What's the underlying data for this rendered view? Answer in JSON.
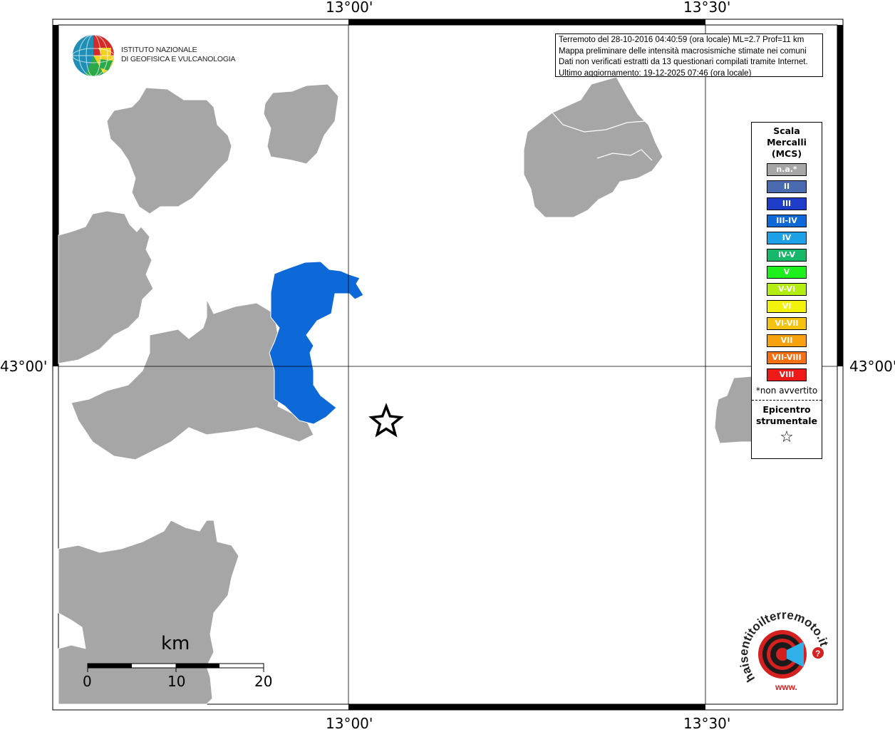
{
  "map": {
    "longitude_labels": [
      "13°00'",
      "13°30'"
    ],
    "latitude_labels": [
      "43°00'"
    ],
    "epicenter_icon": "star-icon"
  },
  "info": {
    "line1": "Terremoto del 28-10-2016 04:40:59 (ora locale) ML=2.7 Prof=11 km",
    "line2": "Mappa preliminare delle intensità macrosismiche stimate nei comuni",
    "line3": "Dati non verificati estratti da 13 questionari compilati tramite Internet.",
    "line4": "Ultimo aggiornamento: 19-12-2025 07:46 (ora locale)"
  },
  "legend": {
    "title_line1": "Scala",
    "title_line2": "Mercalli",
    "title_line3": "(MCS)",
    "items": [
      {
        "label": "n.a.*",
        "color": "#a6a6a6"
      },
      {
        "label": "II",
        "color": "#4a6bb0"
      },
      {
        "label": "III",
        "color": "#1d3cc7"
      },
      {
        "label": "III-IV",
        "color": "#0d68d8"
      },
      {
        "label": "IV",
        "color": "#1ea1e6"
      },
      {
        "label": "IV-V",
        "color": "#18b86a"
      },
      {
        "label": "V",
        "color": "#1ef01e"
      },
      {
        "label": "V-VI",
        "color": "#b4ee10"
      },
      {
        "label": "VI",
        "color": "#f2f20a"
      },
      {
        "label": "VI-VII",
        "color": "#f5c20d"
      },
      {
        "label": "VII",
        "color": "#f7a20d"
      },
      {
        "label": "VII-VIII",
        "color": "#f47012"
      },
      {
        "label": "VIII",
        "color": "#ee1a1a"
      }
    ],
    "note": "*non avvertito",
    "epicenter_line1": "Epicentro",
    "epicenter_line2": "strumentale"
  },
  "ingv": {
    "line1": "ISTITUTO NAZIONALE",
    "line2": "DI GEOFISICA E VULCANOLOGIA"
  },
  "scale": {
    "unit": "km",
    "ticks": [
      "0",
      "10",
      "20"
    ]
  },
  "hsi": {
    "text": "haisentitoilterremoto.it",
    "prefix": "www."
  },
  "colors": {
    "municipality": "#a6a6a6",
    "municipality_intensity": "#0d68d8",
    "border": "#ffffff"
  }
}
